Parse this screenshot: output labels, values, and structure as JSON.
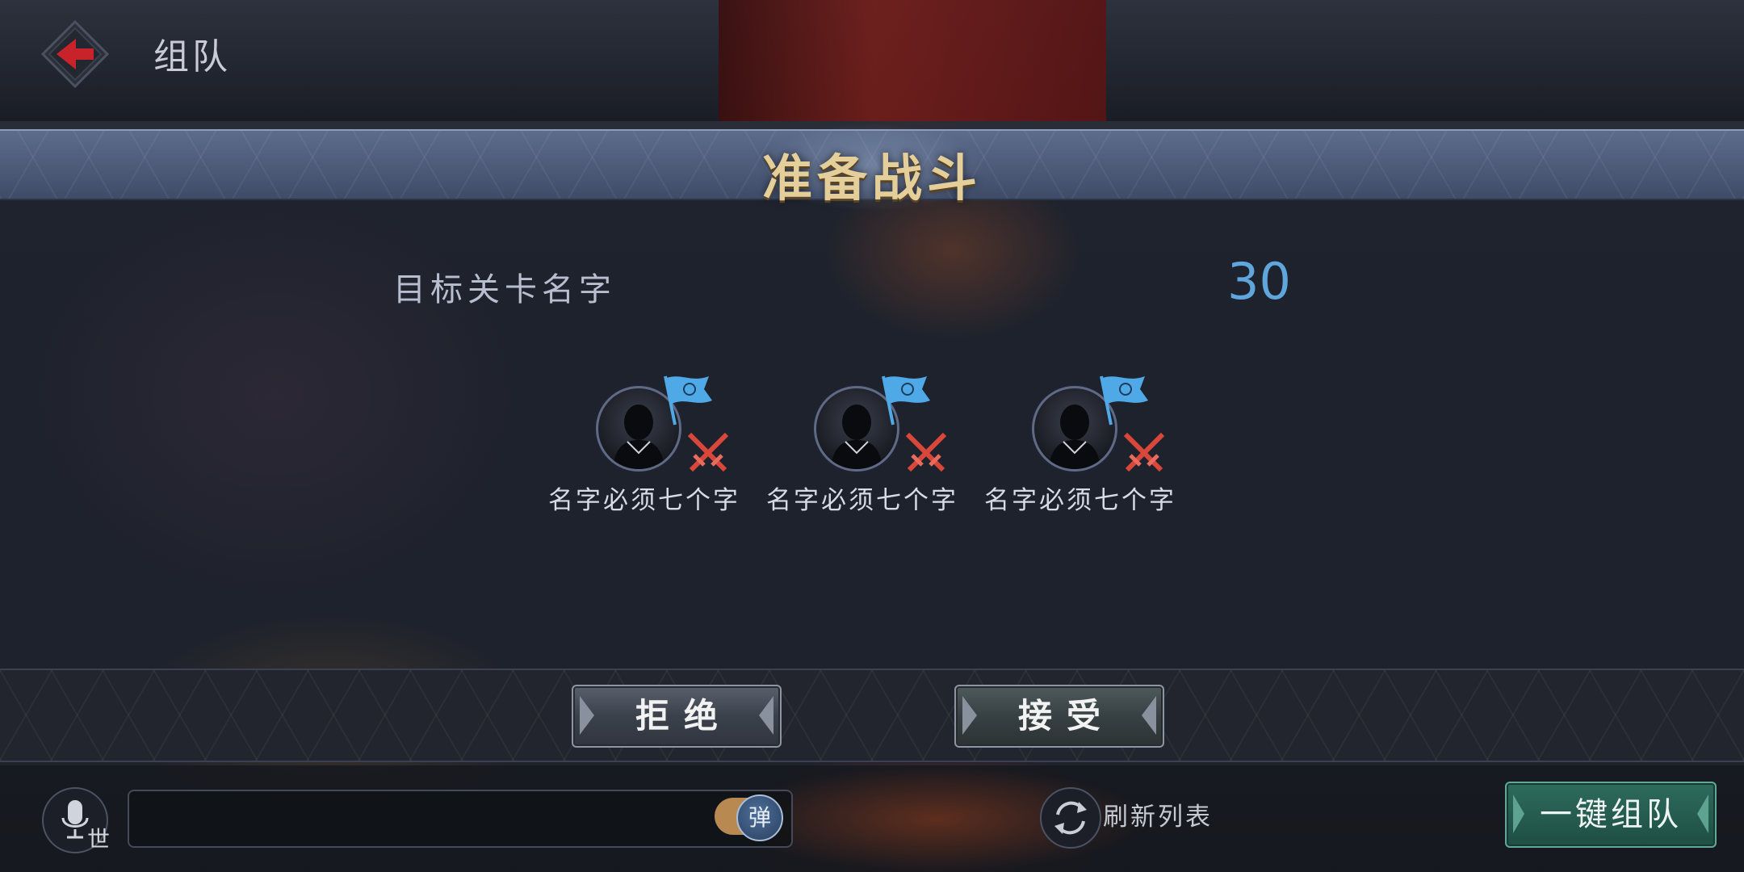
{
  "header": {
    "title": "组队"
  },
  "modal": {
    "title": "准备战斗",
    "stage_name": "目标关卡名字",
    "countdown": "30",
    "members": [
      {
        "name": "名字必须七个字",
        "flag_icon": "blue-team-flag-icon",
        "role_icon": "crossed-swords-icon"
      },
      {
        "name": "名字必须七个字",
        "flag_icon": "blue-team-flag-icon",
        "role_icon": "crossed-swords-icon"
      },
      {
        "name": "名字必须七个字",
        "flag_icon": "blue-team-flag-icon",
        "role_icon": "crossed-swords-icon"
      }
    ],
    "reject_label": "拒绝",
    "accept_label": "接受"
  },
  "bottom_bar": {
    "channel": "世",
    "toggle_label": "弹",
    "refresh_label": "刷新列表",
    "quick_team_label": "一键组队"
  },
  "colors": {
    "title_gold": "#e4cf9a",
    "countdown_blue": "#5fa6dd",
    "back_arrow_red": "#c8232a",
    "flag_blue": "#4fa9e6",
    "swords_red": "#d9463a",
    "quick_team_green": "#2d6b5d"
  }
}
